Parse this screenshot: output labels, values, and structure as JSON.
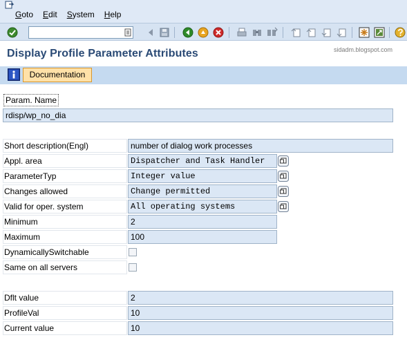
{
  "menu": {
    "items": [
      {
        "label": "Goto",
        "u": "G",
        "rest": "oto"
      },
      {
        "label": "Edit",
        "u": "E",
        "rest": "dit"
      },
      {
        "label": "System",
        "u": "S",
        "rest": "ystem"
      },
      {
        "label": "Help",
        "u": "H",
        "rest": "elp"
      }
    ]
  },
  "toolbar": {
    "command_field_value": "",
    "icons": [
      "enter-icon",
      "back-icon",
      "save-icon",
      "back-green-icon",
      "exit-icon",
      "cancel-icon",
      "print-icon",
      "find-icon",
      "find-next-icon",
      "first-page-icon",
      "previous-page-icon",
      "next-page-icon",
      "last-page-icon",
      "create-session-icon",
      "shortcut-icon",
      "help-icon"
    ]
  },
  "title": {
    "text": "Display Profile Parameter Attributes",
    "watermark": "sidadm.blogspot.com"
  },
  "app_toolbar": {
    "documentation_label": "Documentation"
  },
  "form": {
    "param_name_label": "Param. Name",
    "param_name_value": "rdisp/wp_no_dia",
    "short_desc_label": "Short description(Engl)",
    "short_desc_value": "number of dialog work processes",
    "appl_area_label": "Appl. area",
    "appl_area_value": "Dispatcher and Task Handler",
    "param_type_label": "ParameterTyp",
    "param_type_value": "Integer value",
    "changes_allowed_label": "Changes allowed",
    "changes_allowed_value": "Change permitted",
    "valid_os_label": "Valid for oper. system",
    "valid_os_value": "All operating systems",
    "minimum_label": "Minimum",
    "minimum_value": "2",
    "maximum_label": "Maximum",
    "maximum_value": "100",
    "dyn_switch_label": "DynamicallySwitchable",
    "dyn_switch_checked": false,
    "same_all_label": "Same on all servers",
    "same_all_checked": false,
    "dflt_label": "Dflt value",
    "dflt_value": "2",
    "profile_label": "ProfileVal",
    "profile_value": "10",
    "current_label": "Current value",
    "current_value": "10"
  },
  "colors": {
    "title": "#2a4a75",
    "field_bg": "#dbe7f5",
    "doc_button_bg": "#ffe1a8",
    "app_toolbar_bg": "#c5daf0"
  }
}
